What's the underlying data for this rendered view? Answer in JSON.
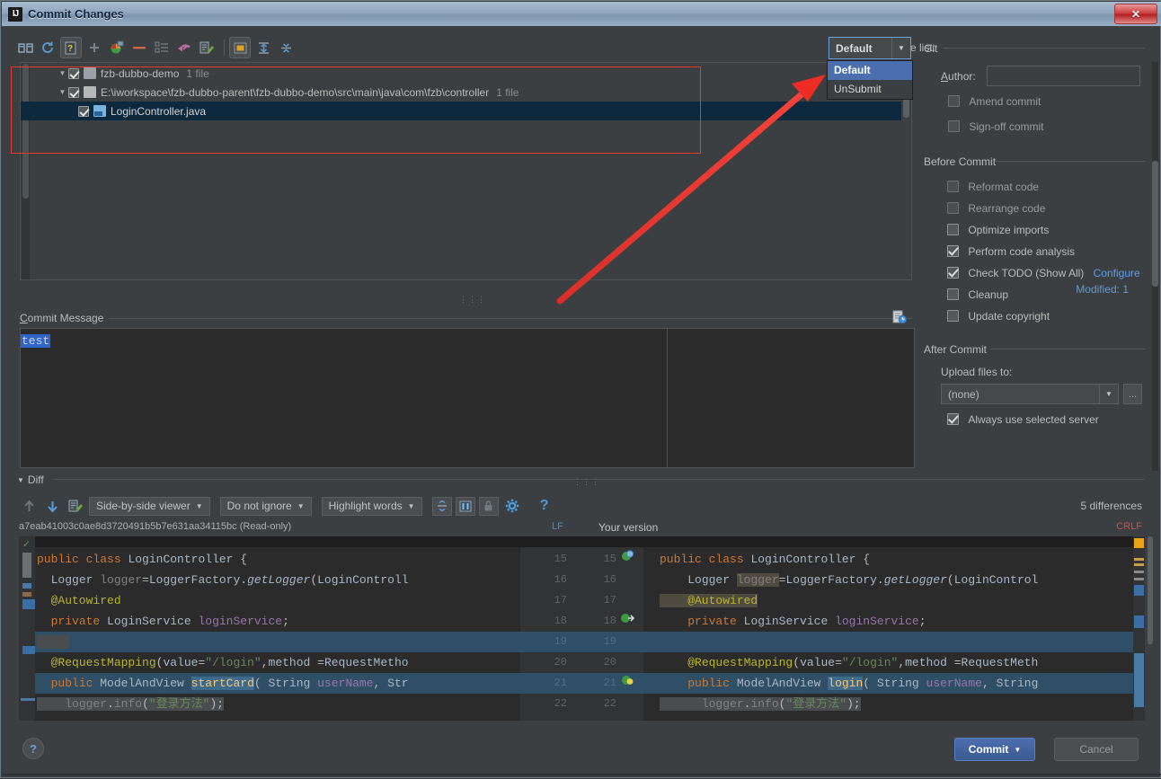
{
  "window": {
    "title": "Commit Changes",
    "app_icon": "intellij-idea-icon",
    "close_label": "✕"
  },
  "toolbar": {
    "icons": [
      {
        "name": "show-diff-icon",
        "glyph": "⚖"
      },
      {
        "name": "refresh-icon",
        "glyph": "↻"
      },
      {
        "name": "show-diff-preview-icon",
        "glyph": "❓"
      },
      {
        "name": "add-icon",
        "glyph": "+"
      },
      {
        "name": "revert-changes-icon",
        "glyph": "◑"
      },
      {
        "name": "delete-icon",
        "glyph": "—"
      },
      {
        "name": "move-to-changelist-icon",
        "glyph": "≡"
      },
      {
        "name": "rollback-icon",
        "glyph": "↶"
      },
      {
        "name": "edit-source-icon",
        "glyph": "✎"
      },
      {
        "name": "group-by-directory-icon",
        "glyph": "▣"
      },
      {
        "name": "expand-all-icon",
        "glyph": "⩛"
      },
      {
        "name": "collapse-all-icon",
        "glyph": "⩜"
      }
    ]
  },
  "changelist": {
    "label": "Change list:",
    "selected": "Default",
    "options": [
      "Default",
      "UnSubmit"
    ],
    "dropdown_open": true
  },
  "tree": {
    "rows": [
      {
        "name": "changelist-root-row",
        "indent": 0,
        "twisty": "▼",
        "checked": true,
        "icon": "changelist-icon",
        "label": "fzb-dubbo-demo",
        "count": "1 file",
        "selected": false
      },
      {
        "name": "directory-row",
        "indent": 1,
        "twisty": "▼",
        "checked": true,
        "icon": "folder-icon",
        "label": "E:\\iworkspace\\fzb-dubbo-parent\\fzb-dubbo-demo\\src\\main\\java\\com\\fzb\\controller",
        "count": "1 file",
        "selected": false
      },
      {
        "name": "file-row",
        "indent": 2,
        "twisty": "",
        "checked": true,
        "icon": "java-file-icon",
        "label": "LoginController.java",
        "count": "",
        "selected": true
      }
    ],
    "modified_status": "Modified: 1"
  },
  "commit_message": {
    "label": "Commit Message",
    "value": "test",
    "history_icon": "commit-message-history-icon"
  },
  "git_section": {
    "title": "Git",
    "author_label": "Author:",
    "author_value": "",
    "options": [
      {
        "name": "amend-commit-checkbox",
        "label": "Amend commit",
        "checked": false
      },
      {
        "name": "sign-off-commit-checkbox",
        "label": "Sign-off commit",
        "checked": false
      }
    ]
  },
  "before_commit": {
    "title": "Before Commit",
    "options": [
      {
        "name": "reformat-code-checkbox",
        "label": "Reformat code",
        "checked": false,
        "dim": true
      },
      {
        "name": "rearrange-code-checkbox",
        "label": "Rearrange code",
        "checked": false,
        "dim": true
      },
      {
        "name": "optimize-imports-checkbox",
        "label": "Optimize imports",
        "checked": false,
        "dim": false
      },
      {
        "name": "perform-code-analysis-checkbox",
        "label": "Perform code analysis",
        "checked": true,
        "dim": false
      },
      {
        "name": "check-todo-checkbox",
        "label": "Check TODO (Show All)",
        "checked": true,
        "dim": false,
        "link": "Configure"
      },
      {
        "name": "cleanup-checkbox",
        "label": "Cleanup",
        "checked": false,
        "dim": false
      },
      {
        "name": "update-copyright-checkbox",
        "label": "Update copyright",
        "checked": false,
        "dim": false
      }
    ]
  },
  "after_commit": {
    "title": "After Commit",
    "upload_label": "Upload files to:",
    "upload_value": "(none)",
    "browse_label": "...",
    "always_use_server": {
      "label": "Always use selected server",
      "checked": true
    }
  },
  "diff": {
    "section_title": "Diff",
    "prev_icon": "previous-difference-icon",
    "next_icon": "next-difference-icon",
    "editor_icon": "open-in-editor-icon",
    "viewer_mode": "Side-by-side viewer",
    "ignore_mode": "Do not ignore",
    "highlight_mode": "Highlight words",
    "collapse_icon": "collapse-unchanged-icon",
    "whitespace_icon": "show-whitespace-icon",
    "lock_icon": "lock-icon",
    "settings_icon": "gear-icon",
    "help_icon": "help-question-icon",
    "differences_count": "5 differences",
    "left_title": "a7eab41003c0ae8d3720491b5b7e631aa34115bc (Read-only)",
    "left_line_ending": "LF",
    "right_title": "Your version",
    "right_line_ending": "CRLF",
    "left_lines": [
      "public class LoginController {",
      "  Logger logger=LoggerFactory.getLogger(LoginControll",
      "  @Autowired",
      "  private LoginService loginService;",
      "",
      "  @RequestMapping(value=\"/login\",method =RequestMetho",
      "  public ModelAndView startCard( String userName, Str",
      "    logger.info(\"登录方法\");"
    ],
    "right_lines": [
      "public class LoginController {",
      "    Logger logger=LoggerFactory.getLogger(LoginControl",
      "    @Autowired",
      "    private LoginService loginService;",
      "",
      "    @RequestMapping(value=\"/login\",method =RequestMeth",
      "    public ModelAndView login( String userName, String",
      "      logger.info(\"登录方法\");"
    ],
    "line_numbers_left": [
      "15",
      "16",
      "17",
      "18",
      "19",
      "20",
      "21",
      "22"
    ],
    "line_numbers_right": [
      "15",
      "16",
      "17",
      "18",
      "19",
      "20",
      "21",
      "22"
    ]
  },
  "footer": {
    "help_label": "?",
    "commit_label": "Commit",
    "commit_caret": "▾",
    "cancel_label": "Cancel"
  },
  "annotation": {
    "type": "red-arrow",
    "color": "#ee2c24"
  },
  "colors": {
    "window_bg": "#3c3f41",
    "editor_bg": "#2b2b2b",
    "accent_blue": "#4b6eaf",
    "selection": "#0d293e",
    "link": "#589df6",
    "annotation_red": "#ee2c24"
  }
}
